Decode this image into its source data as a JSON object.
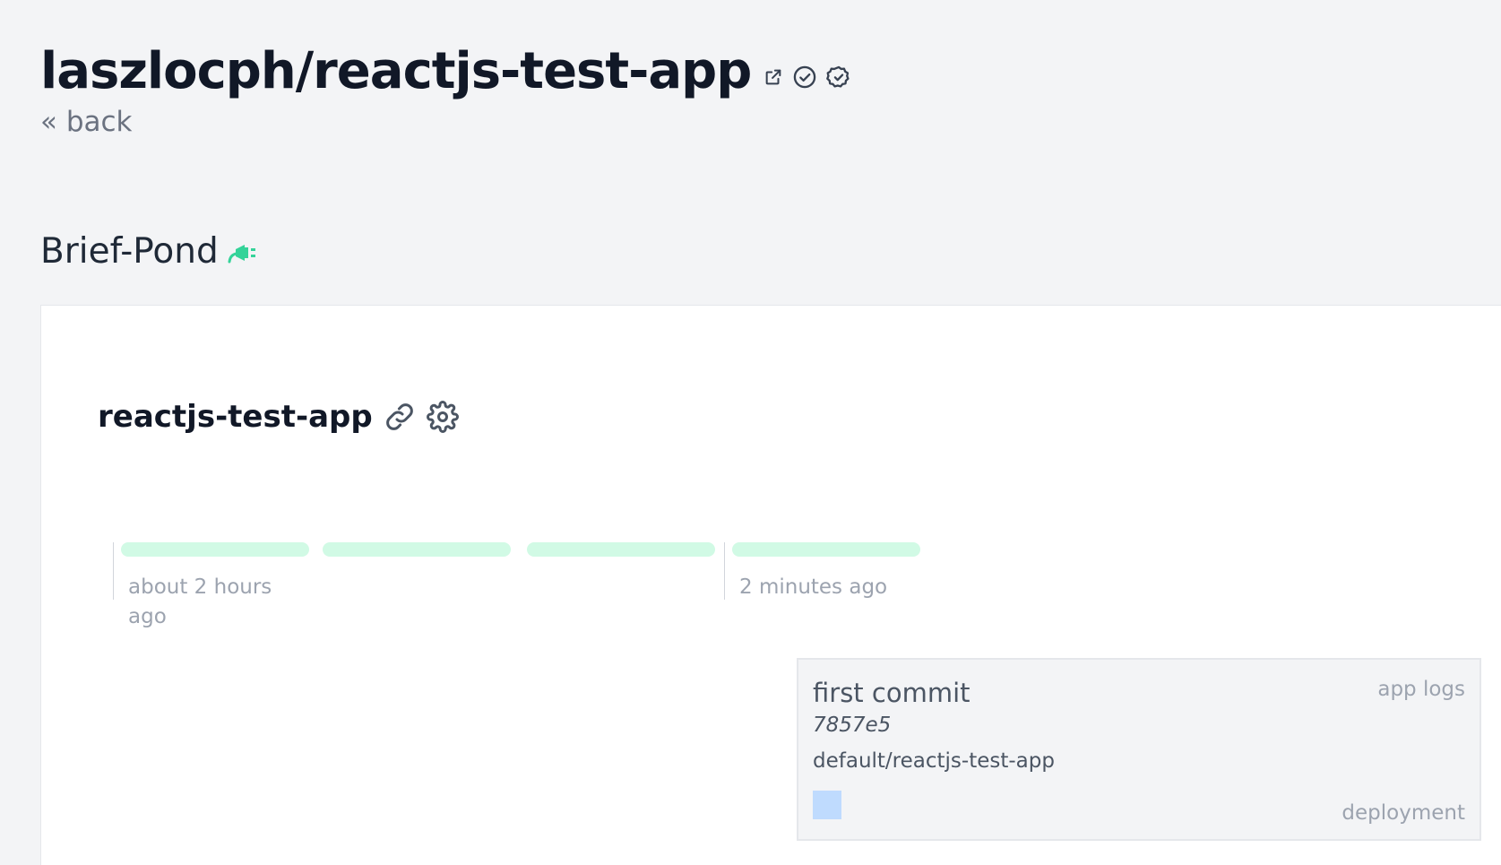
{
  "header": {
    "repo_title": "laszlocph/reactjs-test-app",
    "back_label": "« back",
    "icons": [
      "external-link-icon",
      "check-circle-icon",
      "badge-check-icon"
    ]
  },
  "environment": {
    "name": "Brief-Pond",
    "icon": "plug-icon"
  },
  "app": {
    "name": "reactjs-test-app",
    "icons": [
      "link-icon",
      "gear-icon"
    ]
  },
  "timeline": {
    "segments": 4,
    "labels": [
      "about 2 hours ago",
      "2 minutes ago"
    ]
  },
  "deployment": {
    "commit_message": "first commit",
    "sha": "7857e5",
    "name": "default/reactjs-test-app",
    "logs_label": "app logs",
    "type_label": "deployment"
  },
  "colors": {
    "accent_green": "#34d399",
    "segment_green": "#d1fae5",
    "status_blue": "#bfdbfe",
    "text_dark": "#111827",
    "text_muted": "#9ca3af"
  }
}
